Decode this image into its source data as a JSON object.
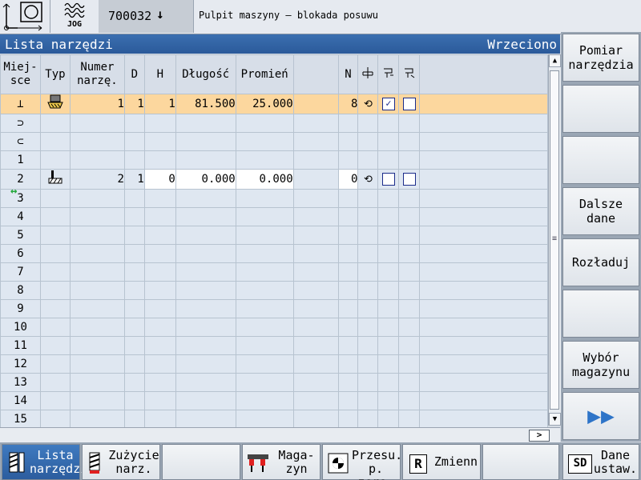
{
  "status": {
    "jog_label": "JOG",
    "program": "700032",
    "program_arrow": "↓",
    "message": "Pulpit maszyny – blokada posuwu"
  },
  "header": {
    "title": "Lista narzędzi",
    "right": "Wrzeciono"
  },
  "columns": {
    "location": [
      "Miej-",
      "sce"
    ],
    "type": "Typ",
    "tool_number": [
      "Numer",
      "narzę."
    ],
    "d": "D",
    "h": "H",
    "length": "Długość",
    "radius": "Promień",
    "n": "N"
  },
  "rows": [
    {
      "loc": "⊥",
      "loc_name": "spindle-location-icon",
      "type": "mill",
      "num": "1",
      "d": "1",
      "h": "1",
      "length": "81.500",
      "radius": "25.000",
      "n": "8",
      "spin": "⟲",
      "cb1": true,
      "cb2": false,
      "selected": true
    },
    {
      "loc": "⊃",
      "loc_name": "gripper1-location-icon"
    },
    {
      "loc": "⊂",
      "loc_name": "gripper2-location-icon"
    },
    {
      "loc": "1"
    },
    {
      "loc": "2",
      "type": "facemill",
      "num": "2",
      "d": "1",
      "h": "0",
      "length": "0.000",
      "radius": "0.000",
      "n": "0",
      "spin": "⟲",
      "cb1": false,
      "cb2": false
    },
    {
      "loc": "3",
      "loc_extra": "↔"
    },
    {
      "loc": "4"
    },
    {
      "loc": "5"
    },
    {
      "loc": "6"
    },
    {
      "loc": "7"
    },
    {
      "loc": "8"
    },
    {
      "loc": "9"
    },
    {
      "loc": "10"
    },
    {
      "loc": "11"
    },
    {
      "loc": "12"
    },
    {
      "loc": "13"
    },
    {
      "loc": "14"
    },
    {
      "loc": "15"
    }
  ],
  "vertical_softkeys": [
    "Pomiar narzędzia",
    "",
    "",
    "Dalsze dane",
    "Rozładuj",
    "",
    "Wybór magazynu",
    "▶▶"
  ],
  "horizontal_softkeys": {
    "tool_list": "Lista narzędzi",
    "tool_wear": "Zużycie narz.",
    "magazine": "Maga- zyn",
    "zero_offset": "Przesu. p. zero.",
    "variables": "Zmienn",
    "setting_data": "Dane ustaw."
  },
  "icons": {
    "sd": "SD",
    "r": "R"
  },
  "colors": {
    "header": "#2b5a9a",
    "selected_row": "#fcd79e",
    "row_bg": "#dfe7f1",
    "checkbox": "#1a2b8a"
  }
}
